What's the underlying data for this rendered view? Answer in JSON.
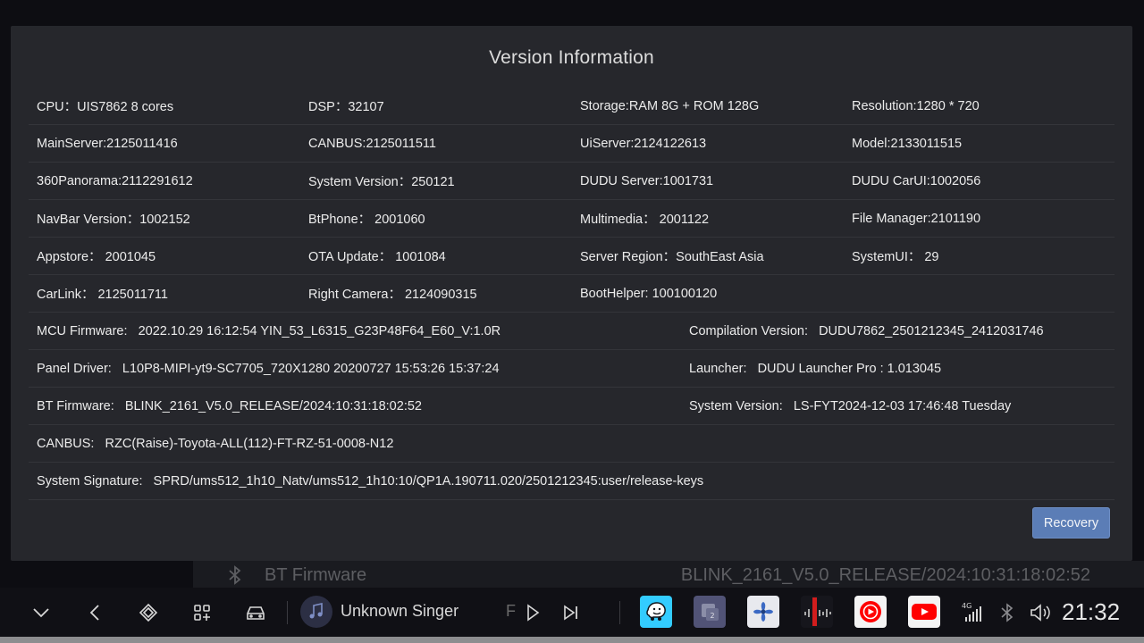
{
  "dialog": {
    "title": "Version Information",
    "rows4": [
      [
        "CPU：UIS7862 8 cores",
        "DSP：32107",
        "Storage:RAM 8G + ROM 128G",
        "Resolution:1280 * 720"
      ],
      [
        "MainServer:2125011416",
        "CANBUS:2125011511",
        "UiServer:2124122613",
        "Model:2133011515"
      ],
      [
        "360Panorama:2112291612",
        "System Version：250121",
        "DUDU Server:1001731",
        "DUDU CarUI:1002056"
      ],
      [
        "NavBar Version：1002152",
        "BtPhone： 2001060",
        "Multimedia： 2001122",
        "File Manager:2101190"
      ],
      [
        "Appstore： 2001045",
        "OTA Update： 1001084",
        "Server Region：SouthEast Asia",
        "SystemUI： 29"
      ],
      [
        "CarLink： 2125011711",
        "Right Camera： 2124090315",
        "BootHelper: 100100120",
        ""
      ]
    ],
    "rows2": [
      [
        "MCU Firmware:   2022.10.29 16:12:54 YIN_53_L6315_G23P48F64_E60_V:1.0R",
        "Compilation Version:   DUDU7862_2501212345_2412031746"
      ],
      [
        "Panel Driver:   L10P8-MIPI-yt9-SC7705_720X1280 20200727 15:53:26 15:37:24",
        "Launcher:   DUDU Launcher Pro : 1.013045"
      ],
      [
        "BT Firmware:   BLINK_2161_V5.0_RELEASE/2024:10:31:18:02:52",
        "System Version:   LS-FYT2024-12-03 17:46:48 Tuesday"
      ]
    ],
    "rows1": [
      "CANBUS:   RZC(Raise)-Toyota-ALL(112)-FT-RZ-51-0008-N12",
      "System Signature:   SPRD/ums512_1h10_Natv/ums512_1h10:10/QP1A.190711.020/2501212345:user/release-keys"
    ],
    "recovery_label": "Recovery"
  },
  "background": {
    "label": "BT Firmware",
    "value": "BLINK_2161_V5.0_RELEASE/2024:10:31:18:02:52"
  },
  "taskbar": {
    "singer": "Unknown Singer",
    "singer_fade": "F",
    "network": "4G",
    "time": "21:32",
    "app_badge": "2",
    "icons": [
      "download-icon",
      "back-icon",
      "home-icon",
      "apps-icon",
      "car-icon",
      "music-note-icon",
      "play-icon",
      "next-icon",
      "waze-icon",
      "file-manager-icon",
      "fan-icon",
      "equalizer-icon",
      "youtube-music-icon",
      "youtube-icon",
      "signal-icon",
      "bluetooth-icon",
      "volume-icon"
    ]
  },
  "colors": {
    "dialog_bg": "#26272c",
    "accent_button": "#5b7db6",
    "waze": "#33ccff",
    "youtube": "#ff0000"
  }
}
